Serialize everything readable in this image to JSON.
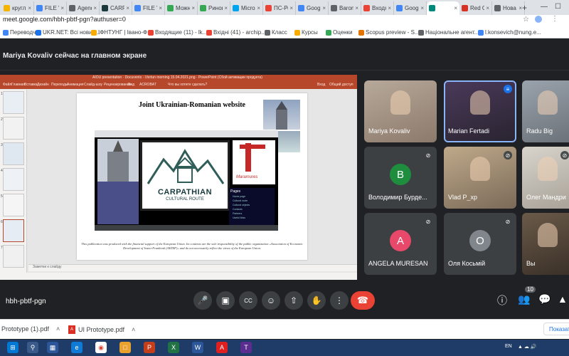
{
  "browser": {
    "tabs": [
      {
        "label": "кругл",
        "color": "#f4b400"
      },
      {
        "label": "FILE VI",
        "color": "#4285f4"
      },
      {
        "label": "Agend",
        "color": "#5f6368"
      },
      {
        "label": "CARPAT",
        "color": "#1a3a3e"
      },
      {
        "label": "FILE VI",
        "color": "#4285f4"
      },
      {
        "label": "Можно",
        "color": "#34a853"
      },
      {
        "label": "Ринок",
        "color": "#34a853"
      },
      {
        "label": "Micros",
        "color": "#00a4ef"
      },
      {
        "label": "ПС-Рос",
        "color": "#ea4335"
      },
      {
        "label": "Googl",
        "color": "#4285f4"
      },
      {
        "label": "Baromet",
        "color": "#5f6368"
      },
      {
        "label": "Входящ",
        "color": "#ea4335"
      },
      {
        "label": "Google",
        "color": "#4285f4"
      },
      {
        "label": "",
        "color": "#00897b"
      },
      {
        "label": "Red Gr",
        "color": "#d93025"
      },
      {
        "label": "Нова в",
        "color": "#5f6368"
      }
    ],
    "new_tab": "+",
    "url": "meet.google.com/hbh-pbtf-pgn?authuser=0",
    "bookmarks": [
      {
        "label": "Переводчик",
        "color": "#4285f4"
      },
      {
        "label": "UKR.NET: Всі новин...",
        "color": "#1a73e8"
      },
      {
        "label": "ІФНТУНГ | Івано-Ф...",
        "color": "#f9ab00"
      },
      {
        "label": "Входящие (11) - lk...",
        "color": "#ea4335"
      },
      {
        "label": "Вхідні (41) - archip...",
        "color": "#ea4335"
      },
      {
        "label": "Класс",
        "color": "#5f6368"
      },
      {
        "label": "Курсы",
        "color": "#f9ab00"
      },
      {
        "label": "Оценки",
        "color": "#34a853"
      },
      {
        "label": "Scopus preview - S...",
        "color": "#e37400"
      },
      {
        "label": "Національне агент...",
        "color": "#5f6368"
      },
      {
        "label": "l.konsevich@nung.e...",
        "color": "#4285f4"
      }
    ]
  },
  "meet": {
    "banner": "Mariya Kovaliv сейчас на главном экране",
    "meeting_code": "hbh-pbtf-pgn",
    "participants_count": "10",
    "participants": [
      {
        "name": "Mariya Kovaliv",
        "avatar": "",
        "avatar_color": ""
      },
      {
        "name": "Marian Fertadi",
        "avatar": "",
        "avatar_color": ""
      },
      {
        "name": "Radu Big",
        "avatar": "",
        "avatar_color": ""
      },
      {
        "name": "Володимир Бурде...",
        "avatar": "В",
        "avatar_color": "#1e8e3e"
      },
      {
        "name": "Vlad P_хр",
        "avatar": "",
        "avatar_color": ""
      },
      {
        "name": "Олег Мандри",
        "avatar": "",
        "avatar_color": ""
      },
      {
        "name": "ANGELA MURESAN",
        "avatar": "A",
        "avatar_color": "#e8496a"
      },
      {
        "name": "Оля Косьмій",
        "avatar": "O",
        "avatar_color": "#80868b"
      },
      {
        "name": "Вы",
        "avatar": "",
        "avatar_color": ""
      }
    ]
  },
  "presentation": {
    "window_title": "AIOU presentation · Docuvents · l.fertun morning 15.04.2021.png · PowerPoint (Сбой активации продукта)",
    "ribbon_tabs": [
      "Файл",
      "Главная",
      "Вставка",
      "Дизайн",
      "Переходы",
      "Анимация",
      "Слайд-шоу",
      "Рецензирование",
      "Вид",
      "ACROBAT",
      "Что вы хотите сделать?"
    ],
    "sign_in": "Вход",
    "share": "Общий доступ",
    "slide_heading": "Joint Ukrainian-Romanian website",
    "logo_text": "CARPATHIAN",
    "logo_subtext": "CULTURAL ROUTE",
    "menu_title": "Pages",
    "menu_items": [
      "Home page",
      "Cultural route",
      "Cultural objects",
      "Contacts",
      "Partners",
      "Useful links"
    ],
    "script_logo": "Maramures",
    "footer_text": "This publication was produced with the financial support of the European Union. Its contents are the sole responsibility of the public organization «Association of Economic Development of Ivano-Frankivsk (AEDIF)» and do not necessarily reflect the views of the European Union.",
    "notes_placeholder": "Заметки к слайду",
    "thumb_numbers": [
      "1",
      "2",
      "3",
      "4",
      "5",
      "6",
      "7"
    ]
  },
  "downloads": {
    "items": [
      {
        "name": "Prototype (1).pdf",
        "icon": "pdf-icon"
      },
      {
        "name": "UI Prototype.pdf",
        "icon": "pdf-icon"
      }
    ],
    "show_all": "Показат"
  },
  "taskbar": {
    "lang": "EN"
  }
}
